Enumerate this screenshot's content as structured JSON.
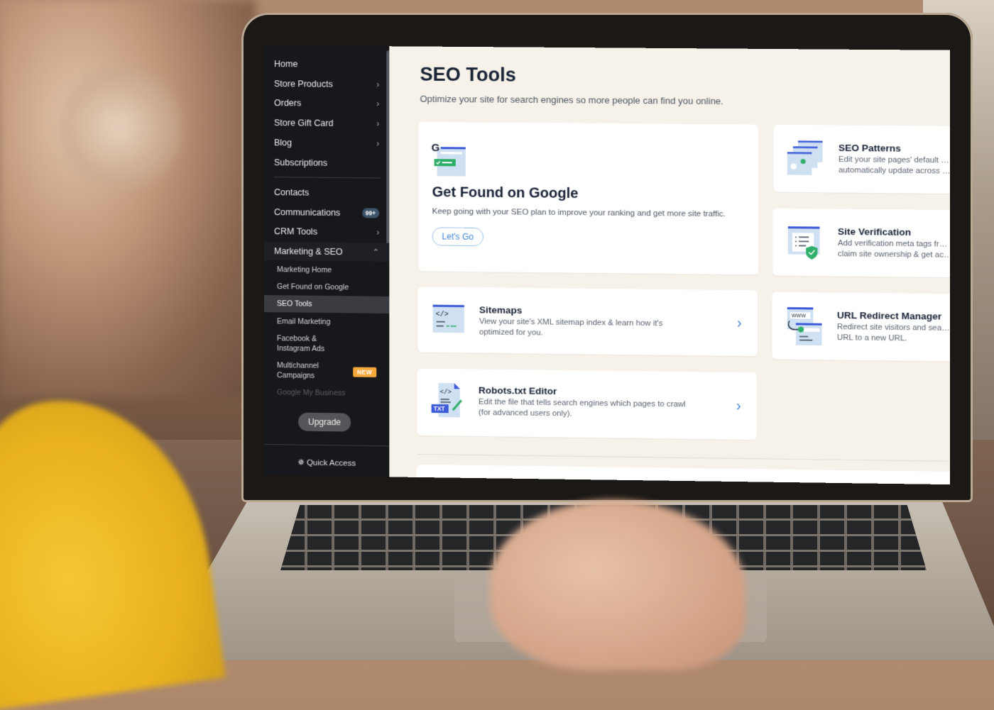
{
  "sidebar": {
    "items": [
      {
        "label": "Home",
        "has_chevron": false
      },
      {
        "label": "Store Products",
        "has_chevron": true
      },
      {
        "label": "Orders",
        "has_chevron": true
      },
      {
        "label": "Store Gift Card",
        "has_chevron": true
      },
      {
        "label": "Blog",
        "has_chevron": true
      },
      {
        "label": "Subscriptions",
        "has_chevron": false
      },
      {
        "label": "Contacts",
        "has_chevron": false
      },
      {
        "label": "Communications",
        "badge": "99+"
      },
      {
        "label": "CRM Tools",
        "has_chevron": true
      },
      {
        "label": "Marketing & SEO",
        "expanded": true
      }
    ],
    "sub_items": [
      {
        "label": "Marketing Home"
      },
      {
        "label": "Get Found on Google"
      },
      {
        "label": "SEO Tools",
        "active": true
      },
      {
        "label": "Email Marketing"
      },
      {
        "label": "Facebook &\nInstagram Ads"
      },
      {
        "label": "Multichannel\nCampaigns",
        "badge": "NEW"
      },
      {
        "label": "Google My Business"
      }
    ],
    "upgrade_label": "Upgrade",
    "quick_access_label": "Quick Access"
  },
  "main": {
    "title": "SEO Tools",
    "subtitle": "Optimize your site for search engines so more people can find you online.",
    "hero": {
      "title": "Get Found on Google",
      "description": "Keep going with your SEO plan to improve your ranking and get more site traffic.",
      "button_label": "Let's Go",
      "icon": "google-search-icon"
    },
    "tools": [
      {
        "title": "Sitemaps",
        "description": "View your site's XML sitemap index & learn how it's optimized for you.",
        "icon": "code-page-icon"
      },
      {
        "title": "Robots.txt Editor",
        "description": "Edit the file that tells search engines which pages to crawl (for advanced users only).",
        "icon": "txt-file-edit-icon"
      },
      {
        "title": "SEO Patterns",
        "description": "Edit your site pages' default … automatically update across …",
        "icon": "stacked-pages-gear-icon"
      },
      {
        "title": "Site Verification",
        "description": "Add verification meta tags fr… claim site ownership & get ac…",
        "icon": "page-shield-icon"
      },
      {
        "title": "URL Redirect Manager",
        "description": "Redirect site visitors and sea… URL to a new URL.",
        "icon": "www-redirect-icon"
      }
    ]
  },
  "colors": {
    "sidebar_bg": "#17181c",
    "main_bg": "#f6f2e9",
    "accent_blue": "#3b82d6",
    "badge_new": "#f5a83a",
    "badge_count": "#3c5368",
    "icon_green": "#2fae6a",
    "icon_blue": "#3d5bd9"
  }
}
